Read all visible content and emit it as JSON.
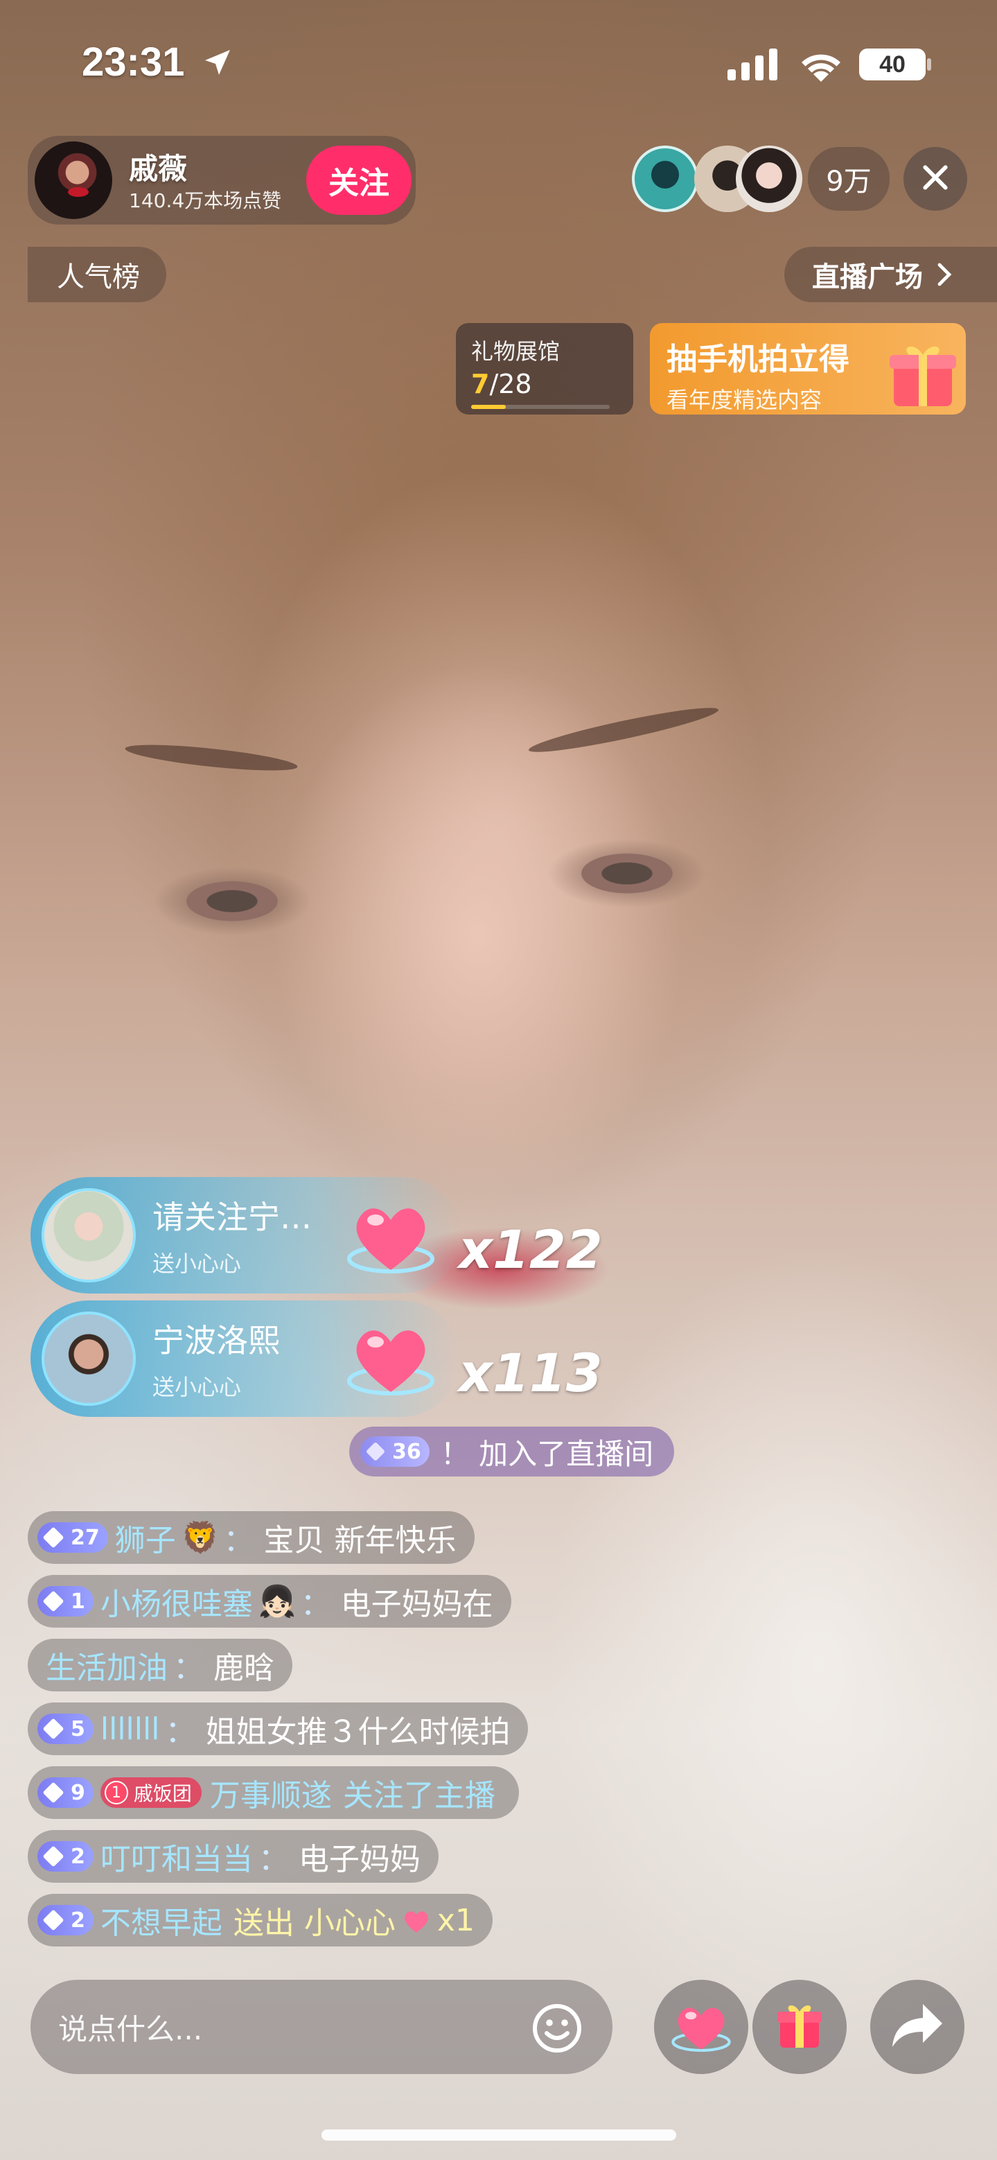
{
  "status_bar": {
    "time": "23:31",
    "battery": "40"
  },
  "streamer": {
    "name": "戚薇",
    "likes": "140.4万本场点赞",
    "follow_label": "关注"
  },
  "header_right": {
    "viewers": "9万"
  },
  "secondary_bar": {
    "popularity_label": "人气榜",
    "plaza_label": "直播广场"
  },
  "gift_hall": {
    "label": "礼物展馆",
    "progress_current": "7",
    "progress_total": "/28",
    "progress_fraction": 0.25
  },
  "promo": {
    "title": "抽手机拍立得",
    "subtitle": "看年度精选内容"
  },
  "gift_notifications": [
    {
      "name": "请关注宁…",
      "action": "送小心心",
      "count": "x122"
    },
    {
      "name": "宁波洛熙",
      "action": "送小心心",
      "count": "x113"
    }
  ],
  "join_notice": {
    "level": "36",
    "text": "！ 加入了直播间"
  },
  "chat": [
    {
      "level": "27",
      "name": "狮子",
      "emoji": "🦁",
      "message": "宝贝  新年快乐"
    },
    {
      "level": "1",
      "name": "小杨很哇塞",
      "emoji": "👧🏻",
      "message": "电子妈妈在"
    },
    {
      "name": "生活加油",
      "message": "鹿晗"
    },
    {
      "level": "5",
      "name": "lllllll",
      "message": "姐姐女推３什么时候拍"
    },
    {
      "level": "9",
      "fan_badge": "戚饭团",
      "fan_level": "1",
      "name": "万事顺遂",
      "message": "关注了主播"
    },
    {
      "level": "2",
      "name": "叮叮和当当",
      "message": "电子妈妈"
    },
    {
      "level": "2",
      "name": "不想早起",
      "message": "送出 小心心",
      "suffix": "x1"
    }
  ],
  "input": {
    "placeholder": "说点什么..."
  },
  "icons": {
    "location": "location-arrow-icon",
    "signal": "cellular-signal-icon",
    "wifi": "wifi-icon",
    "close": "close-icon",
    "chevron": "chevron-right-icon",
    "emoji": "emoji-smile-icon",
    "heart": "heart-gift-icon",
    "gift": "gift-box-icon",
    "share": "share-arrow-icon"
  }
}
